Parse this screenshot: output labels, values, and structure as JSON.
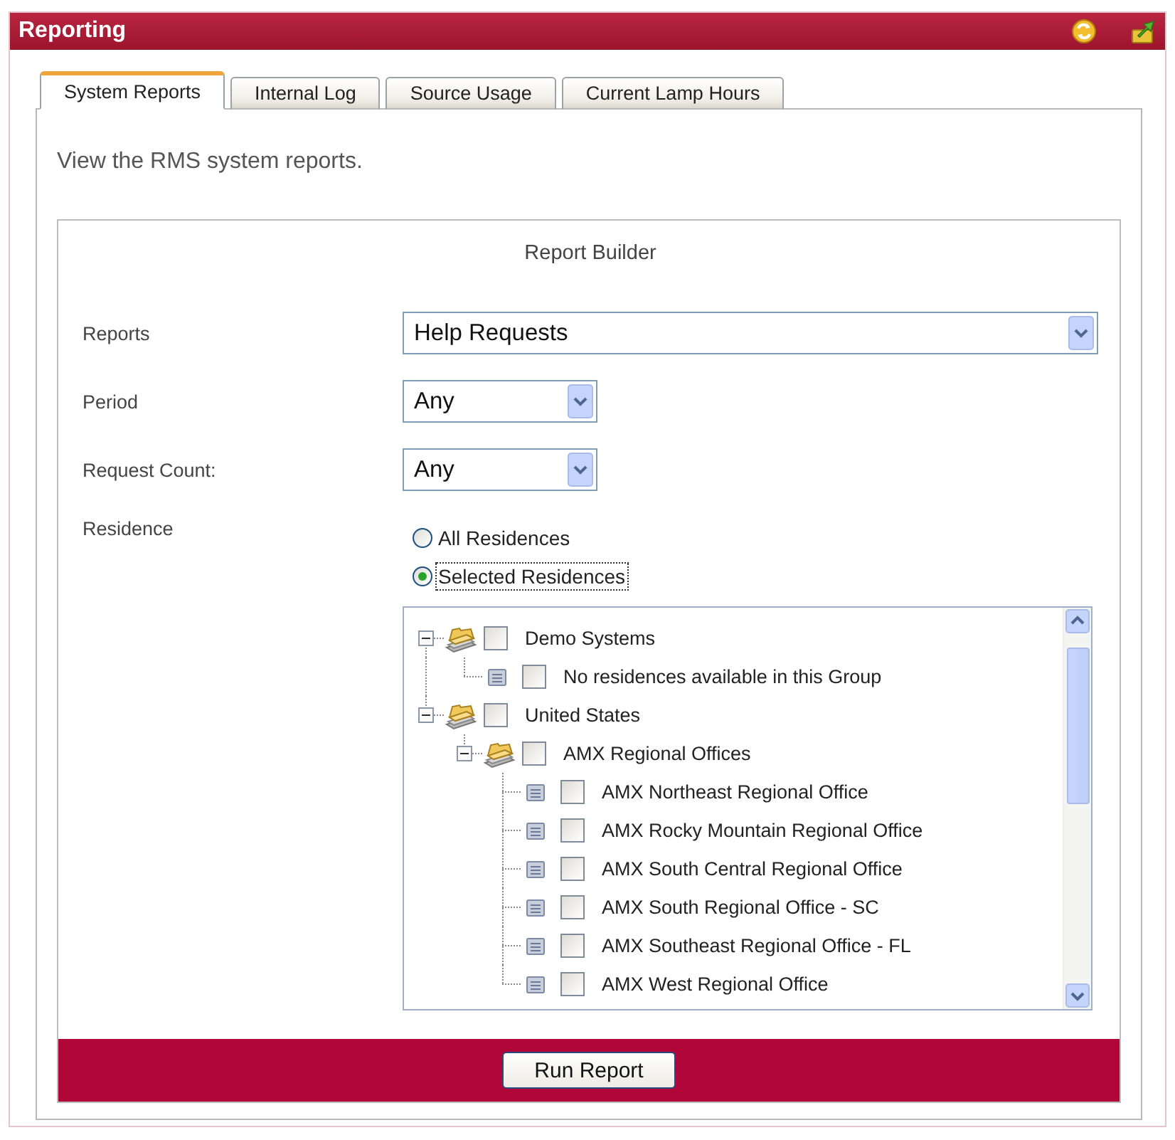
{
  "window": {
    "title": "Reporting"
  },
  "tabs": [
    {
      "label": "System Reports",
      "selected": true
    },
    {
      "label": "Internal Log",
      "selected": false
    },
    {
      "label": "Source Usage",
      "selected": false
    },
    {
      "label": "Current Lamp Hours",
      "selected": false
    }
  ],
  "description": "View the RMS system reports.",
  "report_builder": {
    "title": "Report Builder",
    "dropdowns": [
      {
        "label": "Reports",
        "value": "Help Requests"
      },
      {
        "label": "Period",
        "value": "Any"
      },
      {
        "label": "Request Count:",
        "value": "Any"
      }
    ],
    "residence": {
      "label": "Residence",
      "options": [
        {
          "label": "All Residences",
          "selected": false,
          "focused": false
        },
        {
          "label": "Selected Residences",
          "selected": true,
          "focused": true
        }
      ],
      "tree": [
        {
          "label": "Demo Systems",
          "kind": "group",
          "expanded": true,
          "checked": false,
          "children": [
            {
              "label": "No residences available in this Group",
              "kind": "residence",
              "checked": false
            }
          ]
        },
        {
          "label": "United States",
          "kind": "group",
          "expanded": true,
          "checked": false,
          "children": [
            {
              "label": "AMX Regional Offices",
              "kind": "group",
              "expanded": true,
              "checked": false,
              "children": [
                {
                  "label": "AMX Northeast Regional Office",
                  "kind": "residence",
                  "checked": false
                },
                {
                  "label": "AMX Rocky Mountain Regional Office",
                  "kind": "residence",
                  "checked": false
                },
                {
                  "label": "AMX South Central Regional Office",
                  "kind": "residence",
                  "checked": false
                },
                {
                  "label": "AMX South Regional Office - SC",
                  "kind": "residence",
                  "checked": false
                },
                {
                  "label": "AMX Southeast Regional Office - FL",
                  "kind": "residence",
                  "checked": false
                },
                {
                  "label": "AMX West Regional Office",
                  "kind": "residence",
                  "checked": false
                }
              ]
            }
          ]
        }
      ]
    },
    "run_button": "Run Report"
  }
}
